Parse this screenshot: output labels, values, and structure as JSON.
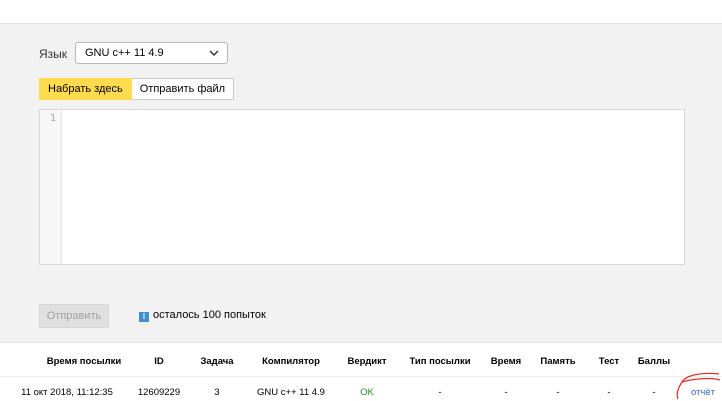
{
  "language": {
    "label": "Язык",
    "selected": "GNU c++ 11 4.9"
  },
  "tabs": [
    {
      "label": "Набрать здесь",
      "active": true
    },
    {
      "label": "Отправить файл",
      "active": false
    }
  ],
  "editor": {
    "line_number": "1"
  },
  "submit_label": "Отправить",
  "attempts_text": "осталось 100 попыток",
  "info_icon_glyph": "i",
  "table": {
    "headers": [
      "Время посылки",
      "ID",
      "Задача",
      "Компилятор",
      "Вердикт",
      "Тип посылки",
      "Время",
      "Память",
      "Тест",
      "Баллы"
    ],
    "rows": [
      {
        "time": "11 окт 2018, 11:12:35",
        "id": "12609229",
        "task": "3",
        "compiler": "GNU c++ 11 4.9",
        "verdict": "OK",
        "type": "-",
        "run_time": "-",
        "memory": "-",
        "test": "-",
        "score": "-",
        "report_label": "отчёт"
      }
    ]
  },
  "colors": {
    "accent": "#ffdb4d",
    "verdict_ok": "#2a8a2a",
    "link": "#3366cc",
    "annotation": "#e0302a"
  }
}
